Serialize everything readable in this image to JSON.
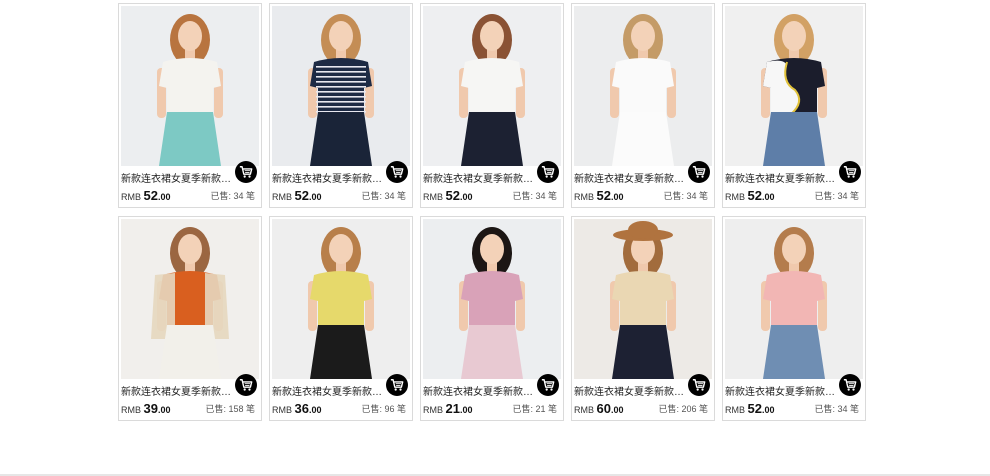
{
  "price_prefix": "RMB",
  "sold_prefix": "已售:",
  "sold_suffix": "笔",
  "products": [
    {
      "title": "新款连衣裙女夏季新款修身显瘦",
      "price_int": "52",
      "price_dec": ".00",
      "sold": "34",
      "top": "#f4f3ef",
      "bottom": "#7dc9c4",
      "hair": "#b8743f",
      "bg": "#eceef0"
    },
    {
      "title": "新款连衣裙女夏季新款修身显瘦",
      "price_int": "52",
      "price_dec": ".00",
      "sold": "34",
      "top": "#1d2a44",
      "bottom": "#1a2438",
      "hair": "#c48d55",
      "bg": "#e9ebee",
      "stripe": true
    },
    {
      "title": "新款连衣裙女夏季新款修身显瘦",
      "price_int": "52",
      "price_dec": ".00",
      "sold": "34",
      "top": "#f6f6f4",
      "bottom": "#1c2132",
      "hair": "#8a5234",
      "bg": "#eeeff1"
    },
    {
      "title": "新款连衣裙女夏季新款修身显瘦",
      "price_int": "52",
      "price_dec": ".00",
      "sold": "34",
      "top": "#fafafa",
      "bottom": "#fbfbfb",
      "hair": "#c49b67",
      "bg": "#ecedee"
    },
    {
      "title": "新款连衣裙女夏季新款修身显瘦",
      "price_int": "52",
      "price_dec": ".00",
      "sold": "34",
      "top": "#1b1d2c",
      "bottom": "#5e7ea8",
      "hair": "#d2a165",
      "bg": "#f0f0f0",
      "wave": true
    },
    {
      "title": "新款连衣裙女夏季新款修身显瘦",
      "price_int": "39",
      "price_dec": ".00",
      "sold": "158",
      "top": "#d95f1f",
      "bottom": "#f2f0ea",
      "hair": "#9b6641",
      "bg": "#f1efec",
      "cardigan": "#e6d7bf"
    },
    {
      "title": "新款连衣裙女夏季新款修身显瘦",
      "price_int": "36",
      "price_dec": ".00",
      "sold": "96",
      "top": "#e6d96b",
      "bottom": "#1b1b1b",
      "hair": "#b87f4a",
      "bg": "#eeeeee"
    },
    {
      "title": "新款连衣裙女夏季新款修身显瘦",
      "price_int": "21",
      "price_dec": ".00",
      "sold": "21",
      "top": "#d9a2b8",
      "bottom": "#e8c9d2",
      "hair": "#1c1614",
      "bg": "#eceef0"
    },
    {
      "title": "新款连衣裙女夏季新款修身显瘦",
      "price_int": "60",
      "price_dec": ".00",
      "sold": "206",
      "top": "#ead7b3",
      "bottom": "#1d2133",
      "hair": "#a26c3d",
      "bg": "#edeae6",
      "hat": true
    },
    {
      "title": "新款连衣裙女夏季新款修身显瘦",
      "price_int": "52",
      "price_dec": ".00",
      "sold": "34",
      "top": "#f2b6b4",
      "bottom": "#6f8eb3",
      "hair": "#b47c4c",
      "bg": "#eeeeee"
    }
  ]
}
